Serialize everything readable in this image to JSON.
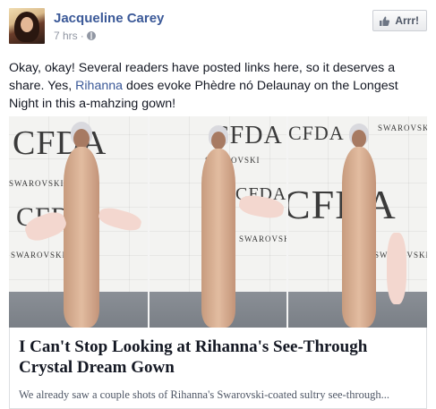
{
  "post": {
    "author_name": "Jacqueline Carey",
    "time": "7 hrs",
    "separator": "·",
    "text_before": "Okay, okay! Several readers have posted links here, so it deserves a share. Yes, ",
    "mention": "Rihanna",
    "text_after": " does evoke Phèdre nó Delaunay on the Longest Night in this a-mahzing gown!",
    "like_label": "Arrr!"
  },
  "photo": {
    "logo_cfda": "C⁠FDA",
    "logo_swarovski": "SWAROVSKI"
  },
  "link_preview": {
    "title": "I Can't Stop Looking at Rihanna's See-Through Crystal Dream Gown",
    "description": "We already saw a couple shots of Rihanna's Swarovski-coated sultry see-through..."
  },
  "colors": {
    "link_blue": "#3b5998",
    "meta_gray": "#9197a3"
  },
  "icons": {
    "like": "thumbs-up-icon",
    "privacy": "globe-icon"
  }
}
